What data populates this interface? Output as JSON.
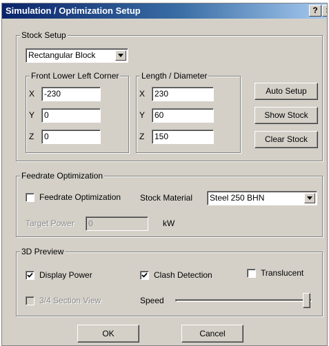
{
  "window": {
    "title": "Simulation / Optimization Setup",
    "help_button": "?",
    "close_button": "×"
  },
  "stock_setup": {
    "group_label": "Stock Setup",
    "stock_type": "Rectangular Block",
    "corner": {
      "label": "Front Lower Left Corner",
      "x_label": "X",
      "x": "-230",
      "y_label": "Y",
      "y": "0",
      "z_label": "Z",
      "z": "0"
    },
    "length": {
      "label": "Length / Diameter",
      "x_label": "X",
      "x": "230",
      "y_label": "Y",
      "y": "60",
      "z_label": "Z",
      "z": "150"
    },
    "buttons": {
      "auto_setup": "Auto Setup",
      "show_stock": "Show Stock",
      "clear_stock": "Clear Stock"
    }
  },
  "feedrate": {
    "group_label": "Feedrate Optimization",
    "checkbox_label": "Feedrate Optimization",
    "checkbox_checked": false,
    "material_label": "Stock Material",
    "material_value": "Steel 250 BHN",
    "target_power_label": "Target Power",
    "target_power_value": "0",
    "target_power_unit": "kW"
  },
  "preview": {
    "group_label": "3D Preview",
    "display_power": {
      "label": "Display Power",
      "checked": true
    },
    "clash_detection": {
      "label": "Clash Detection",
      "checked": true
    },
    "translucent": {
      "label": "Translucent",
      "checked": false
    },
    "section_view": {
      "label": "3/4 Section View",
      "checked": false
    },
    "speed_label": "Speed",
    "speed_level": 1.0
  },
  "footer": {
    "ok": "OK",
    "cancel": "Cancel"
  }
}
